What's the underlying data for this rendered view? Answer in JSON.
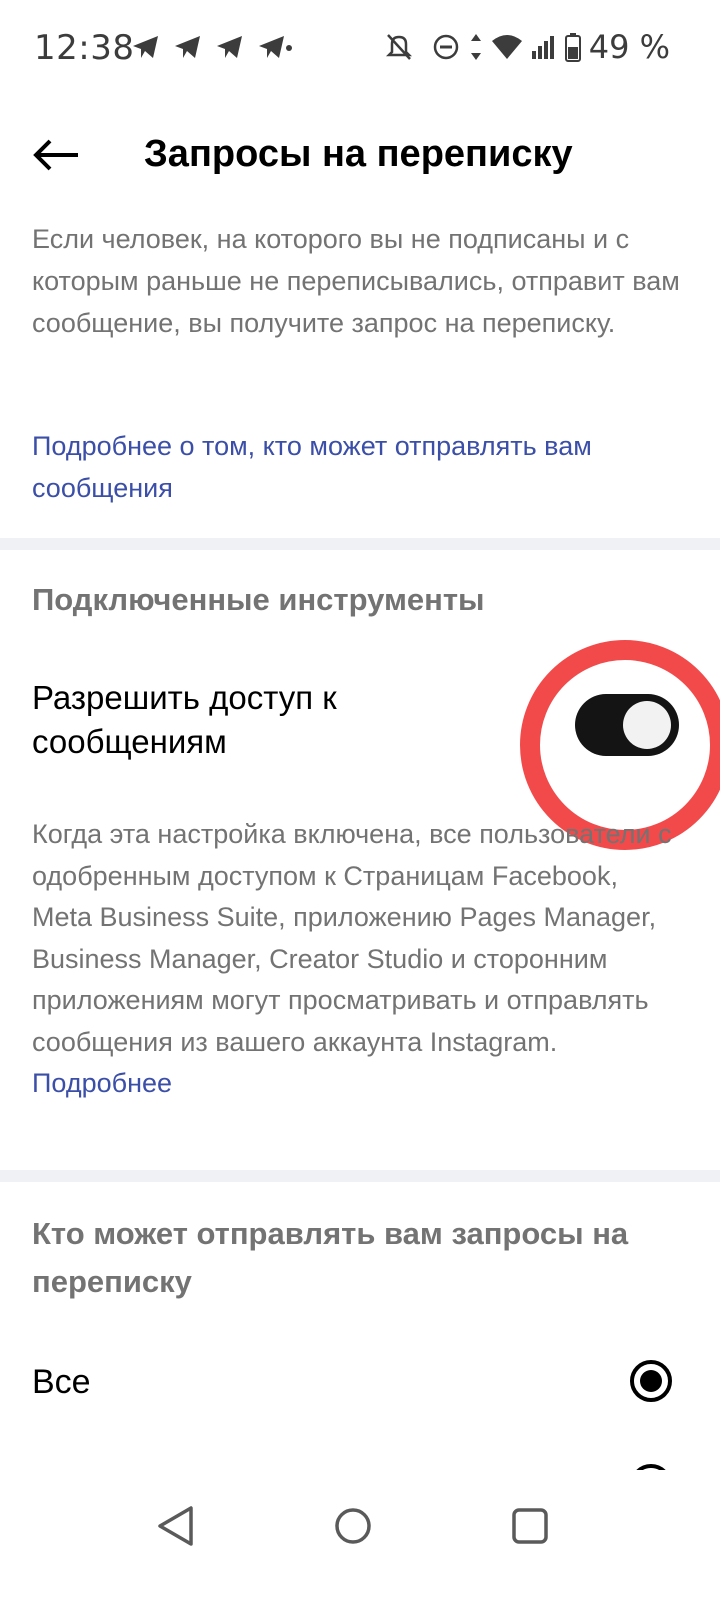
{
  "status_bar": {
    "time": "12:38",
    "battery_text": "49 %"
  },
  "header": {
    "title": "Запросы на переписку",
    "back_icon": "arrow-left-icon"
  },
  "intro": {
    "text": "Если человек, на которого вы не подписаны и с которым раньше не переписывались, отправит вам сообщение, вы получите запрос на переписку.",
    "link": "Подробнее о том, кто может отправлять вам сообщения"
  },
  "connected_tools": {
    "header": "Подключенные инструменты",
    "setting_label": "Разрешить доступ к сообщениям",
    "toggle_on": true,
    "description": "Когда эта настройка включена, все пользователи с одобренным доступом к Страницам Facebook, Meta Business Suite, приложению Pages Manager, Business Manager, Creator Studio и сторонним приложениям могут просматривать и отправлять сообщения из вашего аккаунта Instagram.",
    "description_link": "Подробнее"
  },
  "who_can_send": {
    "header": "Кто может отправлять вам запросы на переписку",
    "options": [
      {
        "label": "Все",
        "selected": true
      }
    ]
  },
  "colors": {
    "link": "#3b4fa8",
    "secondary_text": "#737373",
    "highlight": "#f24a4a",
    "toggle_track": "#141414"
  }
}
